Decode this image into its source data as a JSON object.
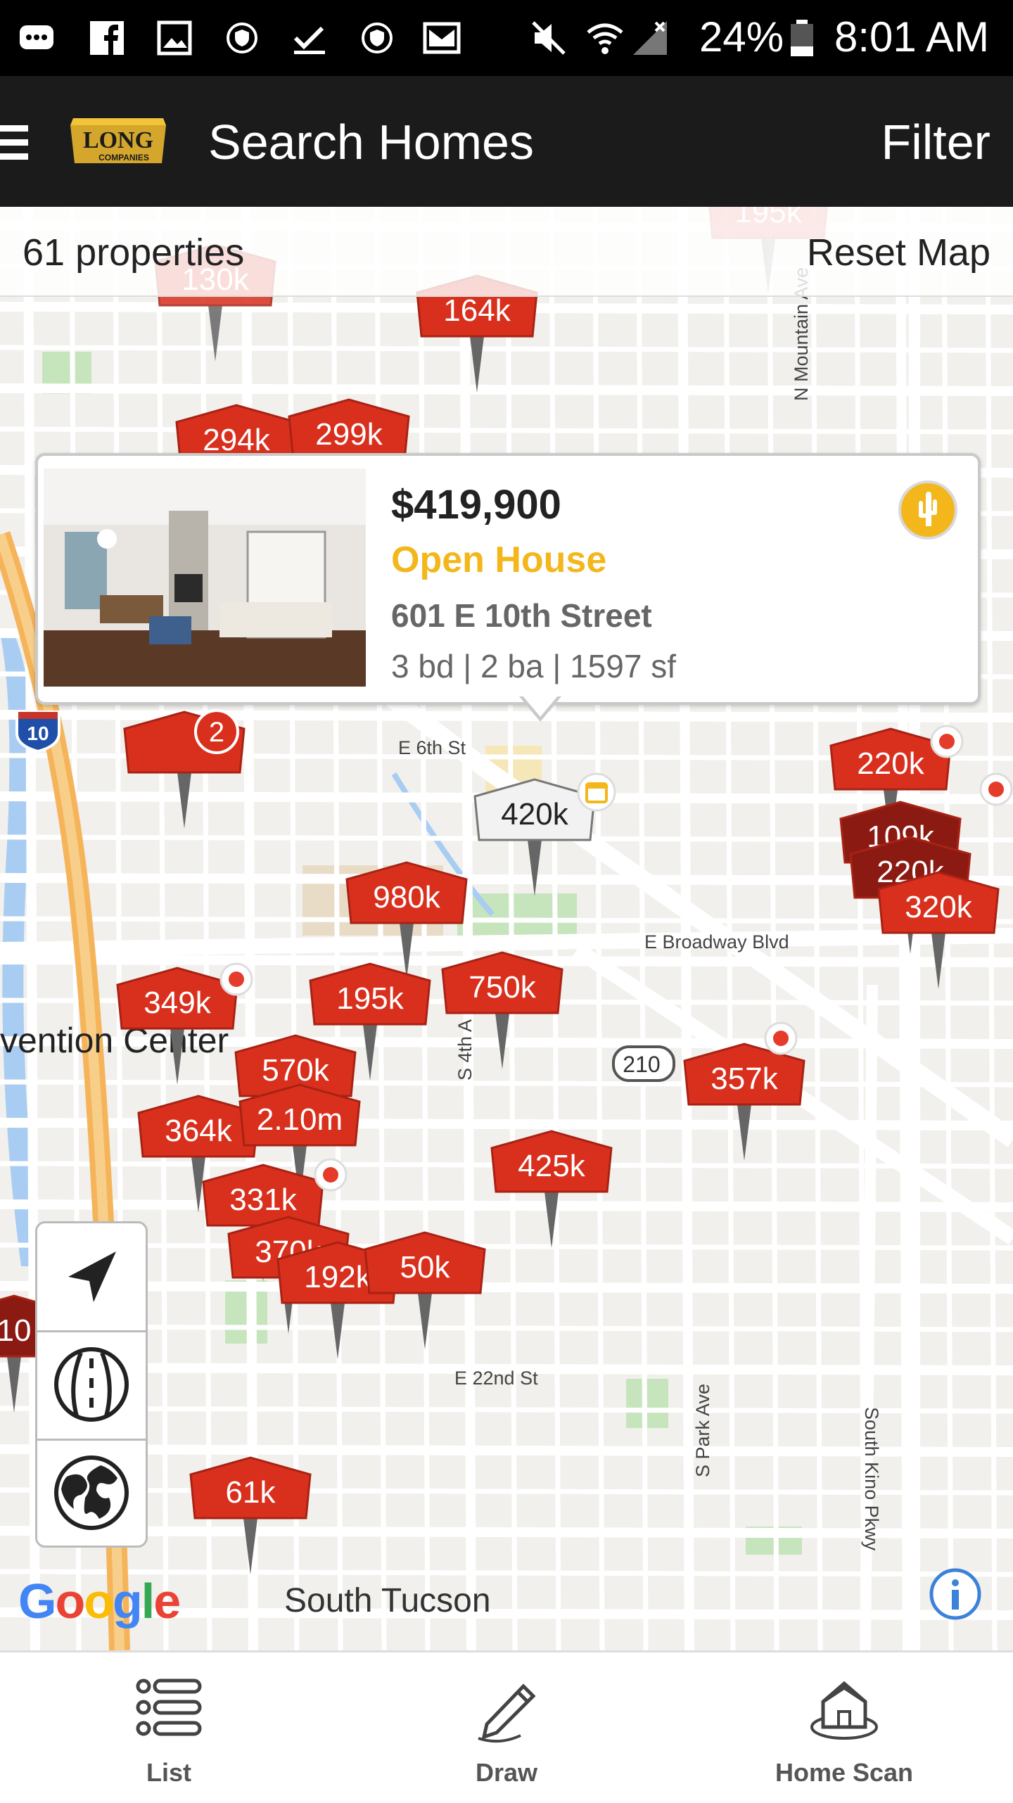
{
  "status_bar": {
    "battery": "24%",
    "time": "8:01 AM",
    "icons": [
      "messenger-icon",
      "facebook-icon",
      "gallery-icon",
      "shield-icon",
      "check-icon",
      "shield-icon",
      "mail-icon",
      "mute-icon",
      "wifi-icon",
      "signal-icon",
      "battery-icon"
    ]
  },
  "header": {
    "logo_text": "LONG",
    "logo_sub": "COMPANIES",
    "title": "Search Homes",
    "filter_label": "Filter"
  },
  "subbar": {
    "count": "61 properties",
    "reset_label": "Reset Map"
  },
  "listing_card": {
    "price": "$419,900",
    "status": "Open House",
    "address": "601 E 10th Street",
    "details": "3 bd | 2 ba | 1597 sf"
  },
  "map_labels": {
    "e6th": "E 6th St",
    "broadway": "E Broadway Blvd",
    "e22nd": "E 22nd St",
    "park": "S Park Ave",
    "kino": "South Kino Pkwy",
    "mountain": "N Mountain Ave",
    "convention": "vention Center",
    "s4th": "S 4th A",
    "hwy10": "10",
    "hwy210": "210",
    "south_tucson": "South Tucson",
    "google": "Google"
  },
  "pins": {
    "p195a": "195k",
    "p130": "130k",
    "p164": "164k",
    "p294": "294k",
    "p299": "299k",
    "p_cluster2": "2",
    "p420": "420k",
    "p220": "220k",
    "p109": "109k",
    "p220b": "220k",
    "p320": "320k",
    "p980": "980k",
    "p349": "349k",
    "p195b": "195k",
    "p750": "750k",
    "p570": "570k",
    "p357": "357k",
    "p364": "364k",
    "p210m": "2.10m",
    "p425": "425k",
    "p331": "331k",
    "p370": "370k",
    "p192": "192k",
    "p50": "50k",
    "p10": "10",
    "p61": "61k"
  },
  "bottom_nav": {
    "list": "List",
    "draw": "Draw",
    "home_scan": "Home Scan"
  },
  "colors": {
    "pin_red": "#d9301e",
    "pin_dark": "#8b1a12",
    "open_house": "#f3b71c",
    "header_bg": "#1b1b1b"
  }
}
